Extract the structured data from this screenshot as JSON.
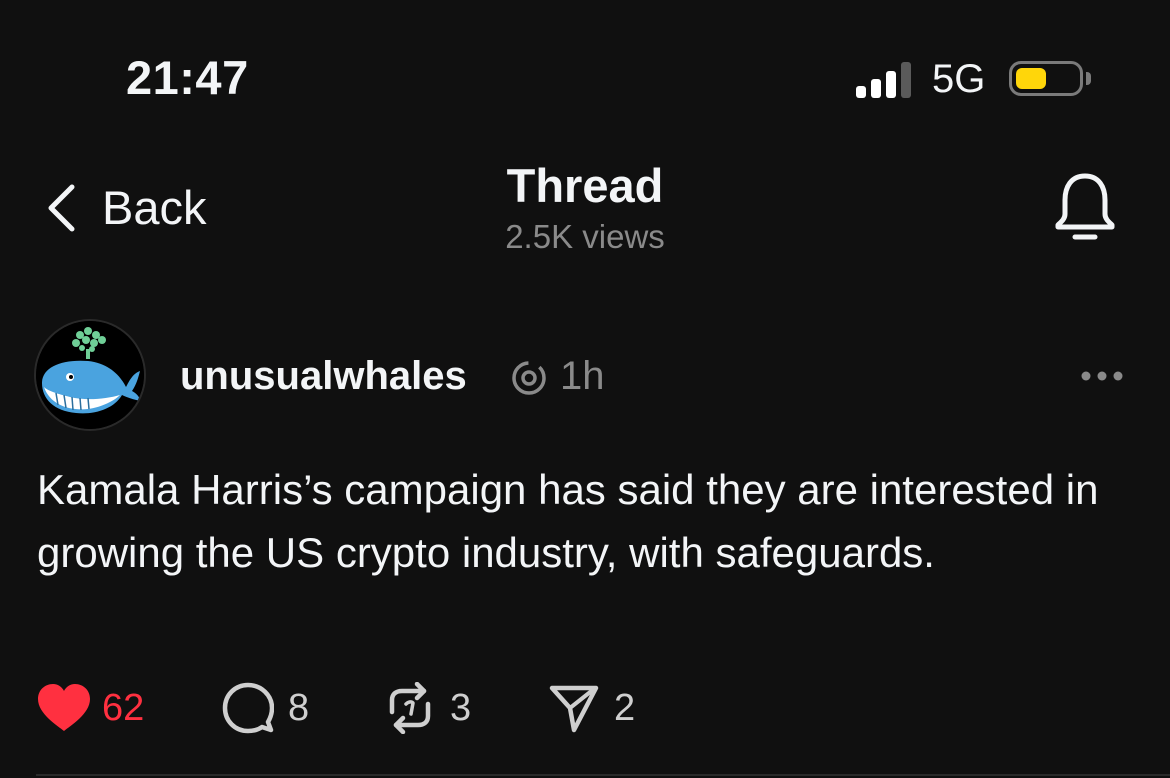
{
  "status_bar": {
    "time": "21:47",
    "network": "5G",
    "signal_bars": 3,
    "signal_bars_total": 4,
    "battery_color": "#ffd60a"
  },
  "header": {
    "back_label": "Back",
    "title": "Thread",
    "subtitle": "2.5K views"
  },
  "post": {
    "username": "unusualwhales",
    "time": "1h",
    "text": "Kamala Harris’s campaign has said they are interested in growing the US crypto industry, with safeguards.",
    "actions": {
      "likes": "62",
      "replies": "8",
      "reposts": "3",
      "shares": "2"
    },
    "liked": true,
    "like_color": "#ff3040"
  },
  "icons": {
    "back": "chevron-left-icon",
    "notifications": "bell-icon",
    "threads": "threads-logo-icon",
    "more": "more-horizontal-icon",
    "like": "heart-icon",
    "reply": "reply-bubble-icon",
    "repost": "repost-icon",
    "share": "send-icon"
  }
}
